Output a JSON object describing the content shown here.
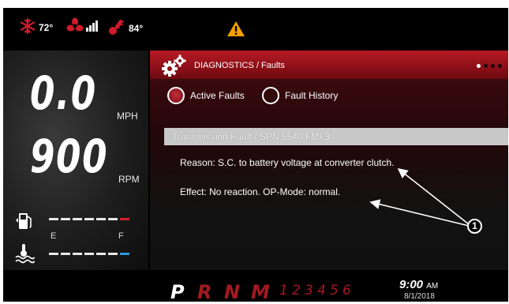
{
  "status_bar": {
    "snow_temp": "72°",
    "fan_signal": "",
    "engine_temp": "84°",
    "warning_icon": "warning-triangle-icon",
    "colors": {
      "red": "#d11a2a",
      "warning": "#f5a000"
    }
  },
  "gauges": {
    "speed_value": "0.0",
    "speed_unit": "MPH",
    "rpm_value": "900",
    "rpm_unit": "RPM",
    "fuel_empty": "E",
    "fuel_full": "F"
  },
  "panel": {
    "title": "DIAGNOSTICS / Faults",
    "page_indicator": {
      "total": 4,
      "active": 1
    },
    "tabs": [
      {
        "label": "Active Faults",
        "selected": true
      },
      {
        "label": "Fault History",
        "selected": false
      }
    ],
    "fault_header": "Transmission Fault / SPN 5540 FMI 3",
    "reason": "Reason: S.C. to battery voltage at converter clutch.",
    "effect": "Effect: No reaction. OP-Mode: normal."
  },
  "gear_selector": {
    "letters": [
      "P",
      "R",
      "N",
      "M"
    ],
    "active": "P",
    "numbers": [
      "1",
      "2",
      "3",
      "4",
      "5",
      "6"
    ]
  },
  "clock": {
    "time": "9:00",
    "ampm": "AM",
    "date": "8/1/2018"
  },
  "callout": {
    "number": "1"
  }
}
